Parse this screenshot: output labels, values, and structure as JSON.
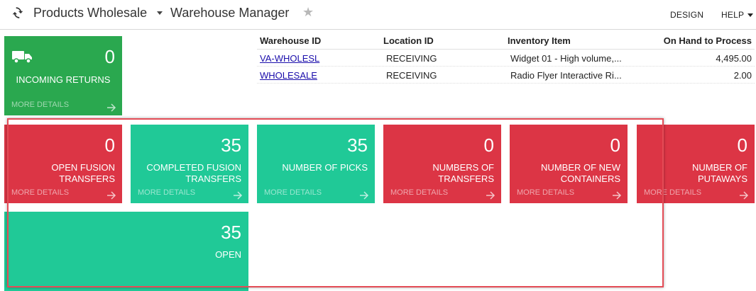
{
  "header": {
    "app_name": "Products Wholesale",
    "page_title": "Warehouse Manager",
    "design_label": "DESIGN",
    "help_label": "HELP"
  },
  "tiles": {
    "incoming_returns": {
      "value": "0",
      "label": "INCOMING RETURNS",
      "more": "MORE DETAILS",
      "color": "#2aa84f"
    },
    "open_fusion": {
      "value": "0",
      "label": "OPEN FUSION TRANSFERS",
      "more": "MORE DETAILS",
      "color": "#dc3545"
    },
    "completed_fusion": {
      "value": "35",
      "label": "COMPLETED FUSION TRANSFERS",
      "more": "MORE DETAILS",
      "color": "#20c997"
    },
    "picks": {
      "value": "35",
      "label": "NUMBER OF PICKS",
      "more": "MORE DETAILS",
      "color": "#20c997"
    },
    "transfers": {
      "value": "0",
      "label": "NUMBERS OF TRANSFERS",
      "more": "MORE DETAILS",
      "color": "#dc3545"
    },
    "containers": {
      "value": "0",
      "label": "NUMBER OF NEW CONTAINERS",
      "more": "MORE DETAILS",
      "color": "#dc3545"
    },
    "putaways": {
      "value": "0",
      "label": "NUMBER OF PUTAWAYS",
      "more": "MORE DETAILS",
      "color": "#dc3545"
    },
    "open": {
      "value": "35",
      "label": "OPEN",
      "color": "#20c997"
    }
  },
  "grid": {
    "columns": [
      "Warehouse ID",
      "Location ID",
      "Inventory Item",
      "On Hand to Process"
    ],
    "rows": [
      {
        "warehouse": "VA-WHOLESL",
        "location": "RECEIVING",
        "item": "Widget 01 - High volume,...",
        "qty": "4,495.00"
      },
      {
        "warehouse": "WHOLESALE",
        "location": "RECEIVING",
        "item": "Radio Flyer Interactive Ri...",
        "qty": "2.00"
      }
    ]
  },
  "icons": [
    "refresh-icon",
    "chevron-down-icon",
    "star-icon",
    "truck-icon",
    "arrow-right-icon"
  ]
}
